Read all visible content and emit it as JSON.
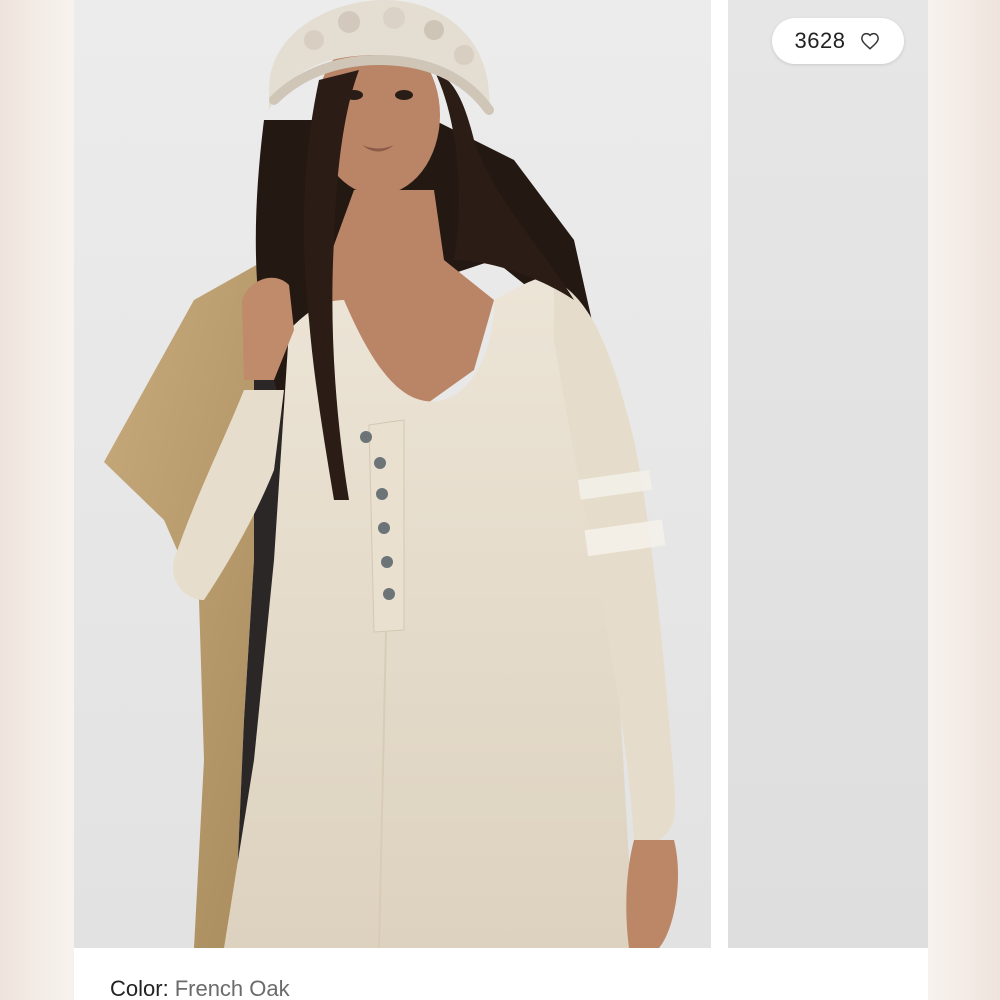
{
  "listing": {
    "likes": {
      "count": "3628",
      "icon": "heart-outline-icon"
    },
    "photo": {
      "description_icon": "product-photo"
    },
    "color": {
      "label": "Color:",
      "value": "French Oak"
    }
  },
  "colors": {
    "page_background": "#f6f1ec",
    "card": "#ffffff",
    "photo_background": "#e9e9e9",
    "dress": "#e3d9c8",
    "coat": "#b89a6a",
    "beanie": "#e4ddd2",
    "hair": "#2a1d17",
    "skin": "#b98566",
    "text_primary": "#222222",
    "text_secondary": "#6b6b6b"
  }
}
